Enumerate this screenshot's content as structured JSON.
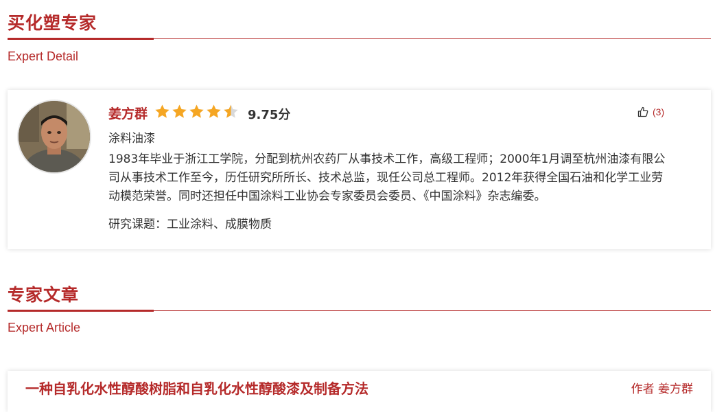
{
  "sections": {
    "detail": {
      "title": "买化塑专家",
      "subtitle": "Expert Detail"
    },
    "articles": {
      "title": "专家文章",
      "subtitle": "Expert Article"
    }
  },
  "expert": {
    "name": "姜方群",
    "rating_stars": 4.5,
    "rating_max": 5,
    "score": "9.75分",
    "likes": "(3)",
    "category": "涂料油漆",
    "bio": "1983年毕业于浙江工学院，分配到杭州农药厂从事技术工作，高级工程师；2000年1月调至杭州油漆有限公司从事技术工作至今，历任研究所所长、技术总监，现任公司总工程师。2012年获得全国石油和化学工业劳动模范荣誉。同时还担任中国涂料工业协会专家委员会委员、《中国涂料》杂志编委。",
    "topics": "研究课题：工业涂料、成膜物质"
  },
  "articles": [
    {
      "title": "一种自乳化水性醇酸树脂和自乳化水性醇酸漆及制备方法",
      "author": "作者 姜方群"
    }
  ],
  "colors": {
    "accent": "#b52a2a",
    "star": "#f5a623"
  }
}
